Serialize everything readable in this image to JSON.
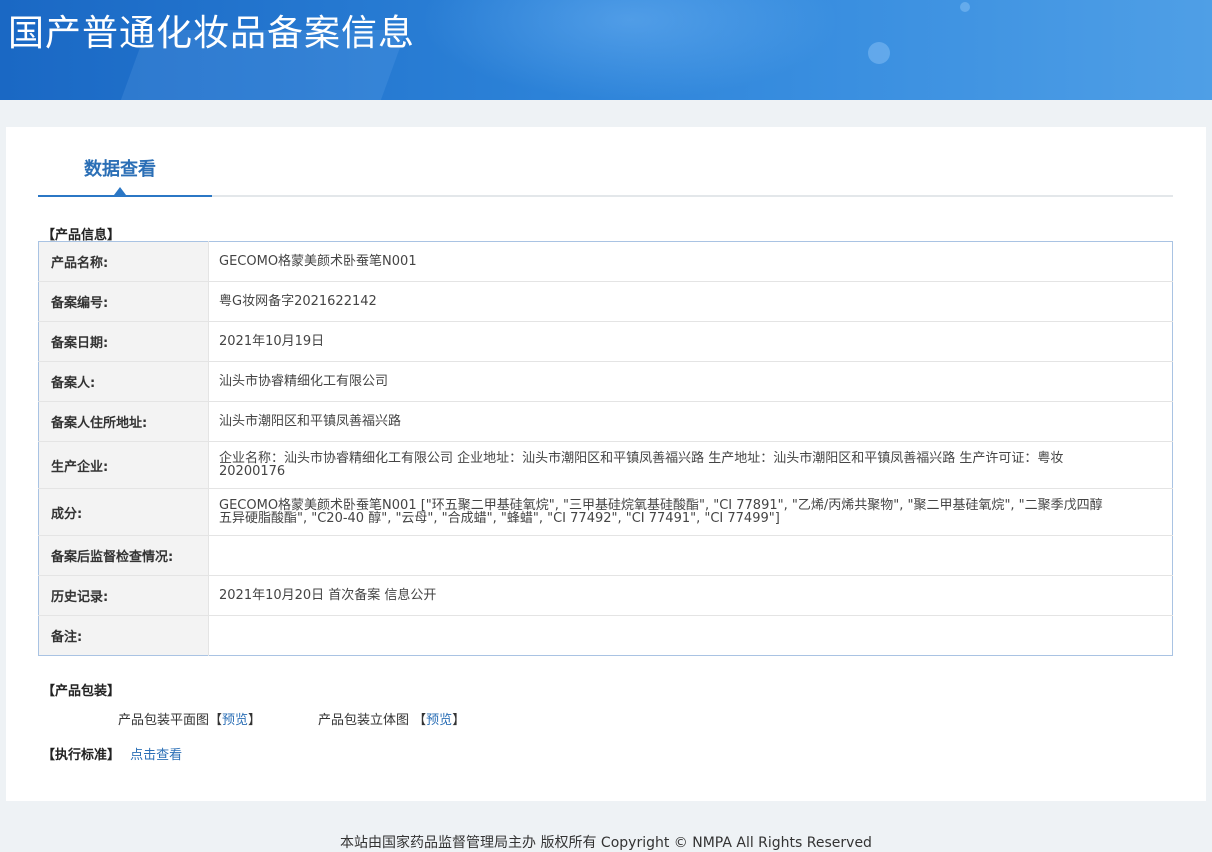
{
  "header": {
    "title": "国产普通化妆品备案信息"
  },
  "tabs": {
    "active_label": "数据查看"
  },
  "product_info": {
    "section_title": "【产品信息】",
    "rows": [
      {
        "label": "产品名称:",
        "value": "GECOMO格蒙美颜术卧蚕笔N001"
      },
      {
        "label": "备案编号:",
        "value": "粤G妆网备字2021622142"
      },
      {
        "label": "备案日期:",
        "value": "2021年10月19日"
      },
      {
        "label": "备案人:",
        "value": "汕头市协睿精细化工有限公司"
      },
      {
        "label": "备案人住所地址:",
        "value": "汕头市潮阳区和平镇凤善福兴路"
      },
      {
        "label": "生产企业:",
        "value": "企业名称：汕头市协睿精细化工有限公司 企业地址：汕头市潮阳区和平镇凤善福兴路 生产地址：汕头市潮阳区和平镇凤善福兴路 生产许可证：粤妆20200176"
      },
      {
        "label": "成分:",
        "value": "GECOMO格蒙美颜术卧蚕笔N001 [\"环五聚二甲基硅氧烷\", \"三甲基硅烷氧基硅酸酯\", \"CI 77891\", \"乙烯/丙烯共聚物\", \"聚二甲基硅氧烷\", \"二聚季戊四醇五异硬脂酸酯\", \"C20-40 醇\", \"云母\", \"合成蜡\", \"蜂蜡\", \"CI 77492\", \"CI 77491\", \"CI 77499\"]"
      },
      {
        "label": "备案后监督检查情况:",
        "value": ""
      },
      {
        "label": "历史记录:",
        "value": "2021年10月20日 首次备案 信息公开"
      },
      {
        "label": "备注:",
        "value": ""
      }
    ]
  },
  "packaging": {
    "section_title": "【产品包装】",
    "flat_label": "产品包装平面图",
    "flat_link_open": "【",
    "flat_link": "预览",
    "flat_link_close": "】",
    "stereo_label": "产品包装立体图",
    "stereo_link_open": "【",
    "stereo_link": "预览",
    "stereo_link_close": "】"
  },
  "standard": {
    "section_title": "【执行标准】",
    "link": "点击查看"
  },
  "footer": {
    "text": "本站由国家药品监督管理局主办 版权所有 Copyright © NMPA All Rights Reserved"
  },
  "colors": {
    "accent": "#2b6fb6",
    "banner": "#2c82d8",
    "table_border": "#a9c3e3"
  }
}
